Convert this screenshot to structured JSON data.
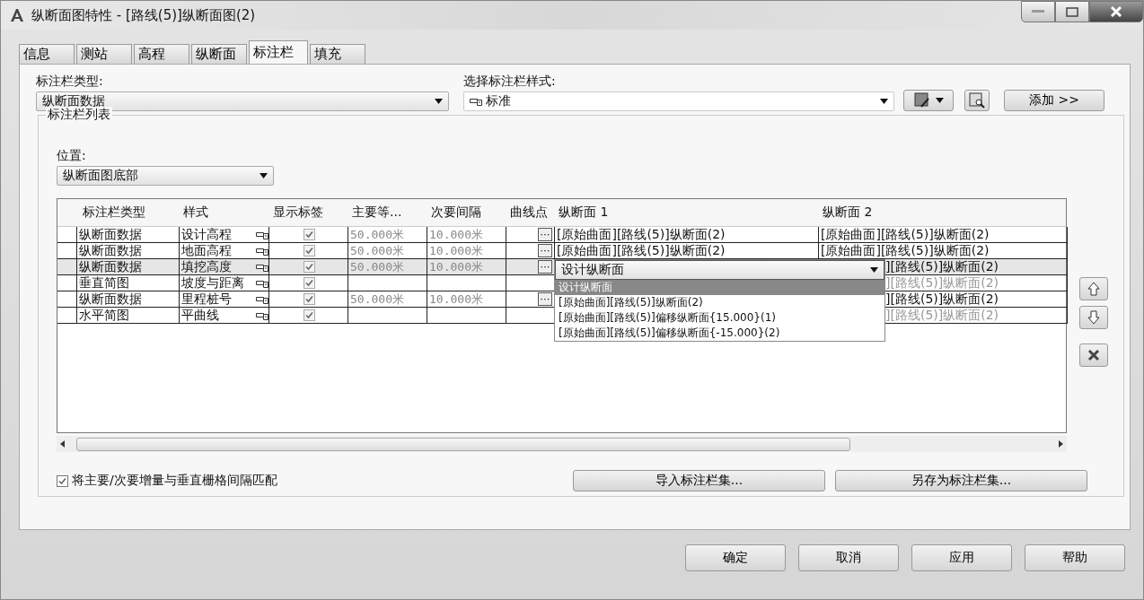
{
  "window": {
    "title": "纵断面图特性 - [路线(5)]纵断面图(2)"
  },
  "tabs": [
    {
      "label": "信息",
      "selected": false
    },
    {
      "label": "测站",
      "selected": false
    },
    {
      "label": "高程",
      "selected": false
    },
    {
      "label": "纵断面",
      "selected": false
    },
    {
      "label": "标注栏",
      "selected": true
    },
    {
      "label": "填充",
      "selected": false
    }
  ],
  "band_type": {
    "label": "标注栏类型:",
    "value": "纵断面数据"
  },
  "band_style": {
    "label": "选择标注栏样式:",
    "value": "标准"
  },
  "add_button": "添加 >>",
  "band_list": {
    "title": "标注栏列表",
    "location": {
      "label": "位置:",
      "value": "纵断面图底部"
    },
    "table": {
      "columns": [
        "标注栏类型",
        "样式",
        "显示标签",
        "主要等...",
        "次要间隔",
        "曲线点",
        "纵断面 1",
        "纵断面 2"
      ],
      "rows": [
        {
          "selected": false,
          "disabled": false,
          "type": "纵断面数据",
          "style": "设计高程",
          "show_labels": true,
          "major": "50.000米",
          "minor": "10.000米",
          "curve_points": "⋯",
          "profile_1": "[原始曲面][路线(5)]纵断面(2)",
          "profile_2": "[原始曲面][路线(5)]纵断面(2)"
        },
        {
          "selected": false,
          "disabled": false,
          "type": "纵断面数据",
          "style": "地面高程",
          "show_labels": true,
          "major": "50.000米",
          "minor": "10.000米",
          "curve_points": "⋯",
          "profile_1": "[原始曲面][路线(5)]纵断面(2)",
          "profile_2": "[原始曲面][路线(5)]纵断面(2)"
        },
        {
          "selected": true,
          "disabled": false,
          "type": "纵断面数据",
          "style": "填挖高度",
          "show_labels": true,
          "major": "50.000米",
          "minor": "10.000米",
          "curve_points": "⋯",
          "profile_1_dropdown": {
            "value": "设计纵断面",
            "options": [
              {
                "label": "设计纵断面",
                "selected": true
              },
              {
                "label": "[原始曲面][路线(5)]纵断面(2)",
                "selected": false
              },
              {
                "label": "[原始曲面][路线(5)]偏移纵断面{15.000}(1)",
                "selected": false
              },
              {
                "label": "[原始曲面][路线(5)]偏移纵断面{-15.000}(2)",
                "selected": false
              }
            ]
          },
          "profile_2": "][路线(5)]纵断面(2)"
        },
        {
          "selected": false,
          "disabled": true,
          "type": "垂直简图",
          "style": "坡度与距离",
          "show_labels": true,
          "profile_2": "][路线(5)]纵断面(2)"
        },
        {
          "selected": false,
          "disabled": false,
          "type": "纵断面数据",
          "style": "里程桩号",
          "show_labels": true,
          "major": "50.000米",
          "minor": "10.000米",
          "curve_points": "⋯",
          "profile_2": "][路线(5)]纵断面(2)"
        },
        {
          "selected": false,
          "disabled": true,
          "type": "水平简图",
          "style": "平曲线",
          "show_labels": true,
          "profile_2": "][路线(5)]纵断面(2)"
        }
      ]
    },
    "match_grid": {
      "label": "将主要/次要增量与垂直栅格间隔匹配",
      "checked": true
    },
    "import_button": "导入标注栏集...",
    "save_button": "另存为标注栏集..."
  },
  "footer_buttons": [
    "确定",
    "取消",
    "应用",
    "帮助"
  ]
}
